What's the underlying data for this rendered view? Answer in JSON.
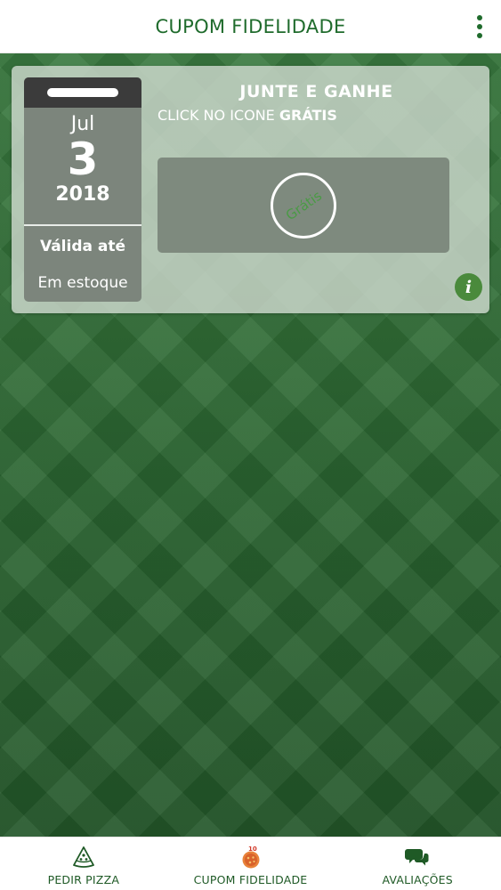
{
  "header": {
    "title": "CUPOM FIDELIDADE",
    "menu_icon": "more-vertical-icon"
  },
  "coupon": {
    "title": "JUNTE E GANHE",
    "subtitle_prefix": "CLICK NO ICONE ",
    "subtitle_bold": "GRÁTIS",
    "date": {
      "month": "Jul",
      "day": "3",
      "year": "2018"
    },
    "valid_label": "Válida até",
    "stock_label": "Em estoque",
    "gratis_label": "Grátis",
    "info_label": "i"
  },
  "bottom_nav": {
    "items": [
      {
        "label": "PEDIR PIZZA",
        "icon": "pizza-slice-icon"
      },
      {
        "label": "CUPOM FIDELIDADE",
        "icon": "loyalty-coupon-icon",
        "icon_text": "10"
      },
      {
        "label": "AVALIAÇÕES",
        "icon": "chat-bubbles-icon"
      }
    ]
  },
  "colors": {
    "accent": "#1f6b2c",
    "background": "#2d6a34",
    "gratis_text": "#4a9a45",
    "info_button": "#4a8a3c"
  }
}
